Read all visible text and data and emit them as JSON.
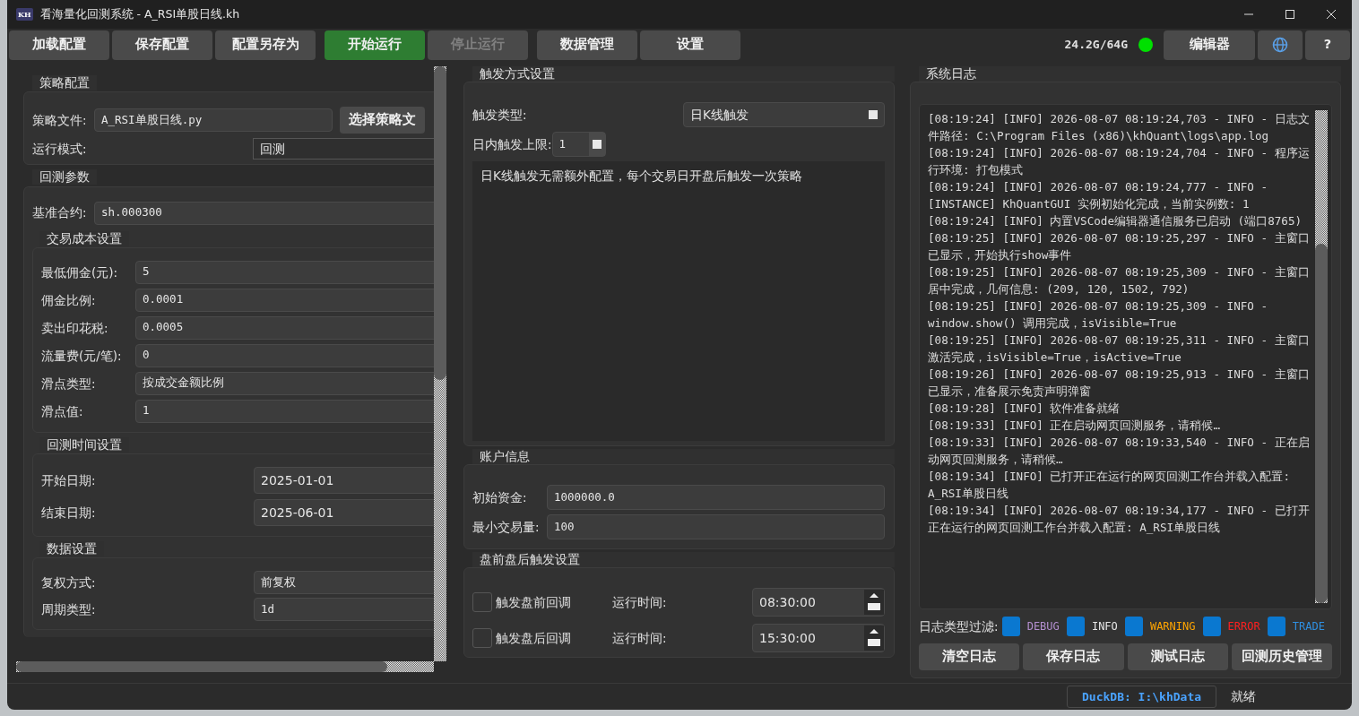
{
  "window": {
    "logo": "KH",
    "title": "看海量化回测系统 - A_RSI单股日线.kh"
  },
  "toolbar": {
    "groups": [
      [
        {
          "label": "加载配置",
          "kind": "normal",
          "disabled": false
        },
        {
          "label": "保存配置",
          "kind": "normal",
          "disabled": false
        },
        {
          "label": "配置另存为",
          "kind": "normal",
          "disabled": false
        }
      ],
      [
        {
          "label": "开始运行",
          "kind": "run",
          "disabled": false
        },
        {
          "label": "停止运行",
          "kind": "normal",
          "disabled": true
        }
      ],
      [
        {
          "label": "数据管理",
          "kind": "normal",
          "disabled": false
        },
        {
          "label": "设置",
          "kind": "normal",
          "disabled": false
        }
      ]
    ],
    "memory": "24.2G/64G",
    "memory_ok": true,
    "editor_button": "编辑器",
    "help_button": "?"
  },
  "strategy": {
    "title": "策略配置",
    "file_label": "策略文件:",
    "file_value": "A_RSI单股日线.py",
    "choose_button": "选择策略文",
    "mode_label": "运行模式:",
    "mode_value": "回测"
  },
  "backtest": {
    "title": "回测参数",
    "benchmark_label": "基准合约:",
    "benchmark_value": "sh.000300",
    "groups": [
      {
        "title": "交易成本设置",
        "kind": "compact",
        "rows": [
          {
            "label": "最低佣金(元):",
            "value": "5"
          },
          {
            "label": "佣金比例:",
            "value": "0.0001"
          },
          {
            "label": "卖出印花税:",
            "value": "0.0005"
          },
          {
            "label": "流量费(元/笔):",
            "value": "0"
          },
          {
            "label": "滑点类型:",
            "value": "按成交金额比例"
          },
          {
            "label": "滑点值:",
            "value": "1"
          }
        ]
      },
      {
        "title": "回测时间设置",
        "kind": "date",
        "rows": [
          {
            "label": "开始日期:",
            "value": "2025-01-01"
          },
          {
            "label": "结束日期:",
            "value": "2025-06-01"
          }
        ]
      },
      {
        "title": "数据设置",
        "kind": "wide",
        "rows": [
          {
            "label": "复权方式:",
            "value": "前复权"
          },
          {
            "label": "周期类型:",
            "value": "1d"
          }
        ]
      }
    ]
  },
  "trigger": {
    "title": "触发方式设置",
    "type_label": "触发类型:",
    "type_value": "日K线触发",
    "limit_label": "日内触发上限:",
    "limit_value": "1",
    "description": "日K线触发无需额外配置，每个交易日开盘后触发一次策略"
  },
  "account": {
    "title": "账户信息",
    "rows": [
      {
        "label": "初始资金:",
        "value": "1000000.0"
      },
      {
        "label": "最小交易量:",
        "value": "100"
      }
    ]
  },
  "prepost": {
    "title": "盘前盘后触发设置",
    "rows": [
      {
        "label": "触发盘前回调",
        "checked": false,
        "time_label": "运行时间:",
        "time": "08:30:00"
      },
      {
        "label": "触发盘后回调",
        "checked": false,
        "time_label": "运行时间:",
        "time": "15:30:00"
      }
    ]
  },
  "log": {
    "title": "系统日志",
    "entries": [
      "[08:19:24] [INFO] 2026-08-07 08:19:24,703 - INFO - 日志文件路径: C:\\Program Files (x86)\\khQuant\\logs\\app.log",
      "[08:19:24] [INFO] 2026-08-07 08:19:24,704 - INFO - 程序运行环境: 打包模式",
      "[08:19:24] [INFO] 2026-08-07 08:19:24,777 - INFO - [INSTANCE] KhQuantGUI 实例初始化完成，当前实例数: 1",
      "[08:19:24] [INFO] 内置VSCode编辑器通信服务已启动 (端口8765)",
      "[08:19:25] [INFO] 2026-08-07 08:19:25,297 - INFO - 主窗口已显示，开始执行show事件",
      "[08:19:25] [INFO] 2026-08-07 08:19:25,309 - INFO - 主窗口居中完成，几何信息: (209, 120, 1502, 792)",
      "[08:19:25] [INFO] 2026-08-07 08:19:25,309 - INFO - window.show() 调用完成，isVisible=True",
      "[08:19:25] [INFO] 2026-08-07 08:19:25,311 - INFO - 主窗口激活完成，isVisible=True，isActive=True",
      "[08:19:26] [INFO] 2026-08-07 08:19:25,913 - INFO - 主窗口已显示，准备展示免责声明弹窗",
      "[08:19:28] [INFO] 软件准备就绪",
      "[08:19:33] [INFO] 正在启动网页回测服务，请稍候…",
      "[08:19:33] [INFO] 2026-08-07 08:19:33,540 - INFO - 正在启动网页回测服务，请稍候…",
      "[08:19:34] [INFO] 已打开正在运行的网页回测工作台并载入配置: A_RSI单股日线",
      "[08:19:34] [INFO] 2026-08-07 08:19:34,177 - INFO - 已打开正在运行的网页回测工作台并载入配置: A_RSI单股日线"
    ],
    "filter_label": "日志类型过滤:",
    "filters": [
      {
        "label": "DEBUG",
        "checked": true,
        "color": "#b48fd0"
      },
      {
        "label": "INFO",
        "checked": true,
        "color": "#e6e6e6"
      },
      {
        "label": "WARNING",
        "checked": true,
        "color": "#ffa500"
      },
      {
        "label": "ERROR",
        "checked": true,
        "color": "#ff2020"
      },
      {
        "label": "TRADE",
        "checked": true,
        "color": "#2f8fe0"
      }
    ],
    "buttons": [
      "清空日志",
      "保存日志",
      "测试日志",
      "回测历史管理"
    ]
  },
  "status_bar": {
    "database": "DuckDB: I:\\khData",
    "status": "就绪"
  }
}
